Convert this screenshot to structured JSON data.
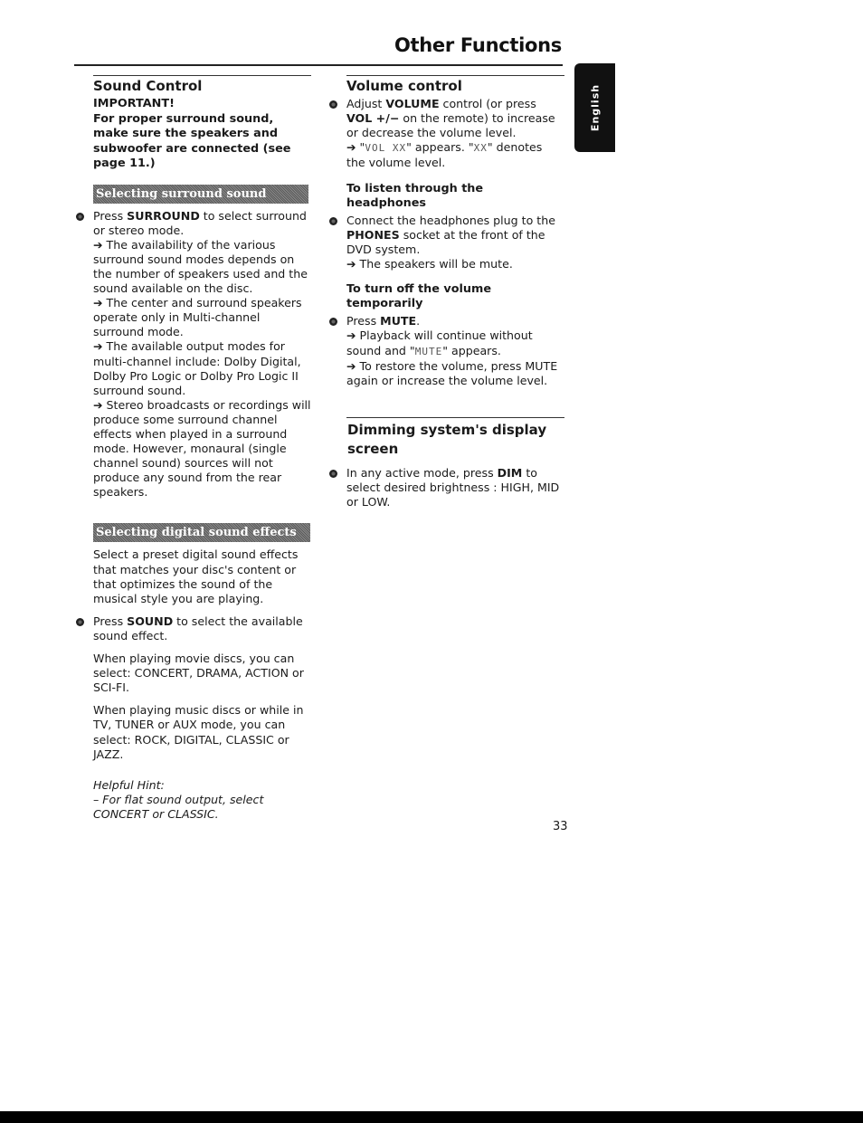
{
  "header": {
    "title": "Other Functions",
    "language_tab": "English"
  },
  "left": {
    "title": "Sound Control",
    "important_label": "IMPORTANT!",
    "important_text": "For proper surround sound, make sure the speakers and subwoofer are connected (see page 11.)",
    "surround": {
      "banner": "Selecting surround sound",
      "step_pre": "Press ",
      "step_key": "SURROUND",
      "step_post": " to select surround or stereo mode.",
      "notes": [
        "➔ The availability of the various surround sound modes depends on the number of speakers used and the sound available on the disc.",
        "➔ The center and surround speakers operate only in Multi-channel surround mode.",
        "➔ The available output modes for multi-channel include: Dolby Digital, Dolby Pro Logic or Dolby Pro Logic II surround sound.",
        "➔ Stereo broadcasts or recordings will produce some surround channel effects when played in a surround mode. However, monaural (single channel sound) sources will not produce any sound from the rear speakers."
      ]
    },
    "effects": {
      "banner": "Selecting digital sound effects",
      "intro": "Select a preset digital sound effects that matches your disc's content or that optimizes the sound of the musical style you are playing.",
      "step_pre": "Press ",
      "step_key": "SOUND",
      "step_post": " to select the available sound effect.",
      "movie": "When playing movie discs, you can select: CONCERT, DRAMA, ACTION or SCI-FI.",
      "music": "When playing music discs or while in TV, TUNER or AUX mode, you can select: ROCK, DIGITAL, CLASSIC or JAZZ.",
      "hint_label": "Helpful Hint:",
      "hint_text": "– For flat sound output, select CONCERT or CLASSIC."
    }
  },
  "right": {
    "title": "Volume control",
    "volume": {
      "pre": "Adjust ",
      "key1": "VOLUME",
      "mid": " control (or press ",
      "key2": "VOL +/−",
      "post": " on the remote) to increase or decrease the volume level.",
      "note_pre": "➔ \"",
      "lcd1": "VOL XX",
      "note_mid": "\" appears. \"",
      "lcd2": "XX",
      "note_post": "\" denotes the volume level."
    },
    "headphones": {
      "title": "To listen through the headphones",
      "pre": "Connect the headphones plug to the ",
      "key": "PHONES",
      "post": " socket at the front of the DVD system.",
      "note": "➔ The speakers will be mute."
    },
    "mute": {
      "title": "To turn off the volume temporarily",
      "pre": "Press ",
      "key": "MUTE",
      "post": ".",
      "note1_pre": "➔ Playback will continue without sound and \"",
      "lcd": "MUTE",
      "note1_post": "\" appears.",
      "note2": "➔ To restore the volume, press MUTE again or increase the volume level."
    },
    "dim": {
      "title": "Dimming system's display screen",
      "pre": "In any active mode, press ",
      "key": "DIM",
      "post": " to select desired brightness : HIGH, MID or LOW."
    }
  },
  "footer": {
    "page_number": "33"
  }
}
